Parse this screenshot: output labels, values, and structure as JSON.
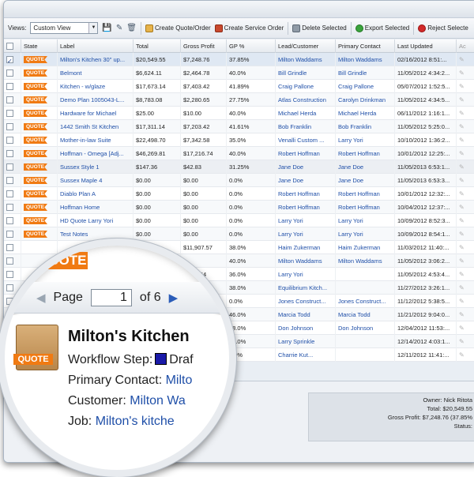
{
  "toolbar": {
    "views_label": "Views:",
    "view_value": "Custom View",
    "create_quote": "Create Quote/Order",
    "create_service": "Create Service Order",
    "delete_selected": "Delete Selected",
    "export_selected": "Export Selected",
    "reject_selected": "Reject Selecte"
  },
  "columns": [
    "State",
    "Label",
    "Total",
    "Gross Profit",
    "GP %",
    "Lead/Customer",
    "Primary Contact",
    "Last Updated",
    "Ac"
  ],
  "rows": [
    {
      "badge": "QUOTE",
      "label": "Milton's Kitchen 30\" up...",
      "total": "$20,549.55",
      "gp": "$7,248.76",
      "gpp": "37.85%",
      "lead": "Milton Waddams",
      "contact": "Milton Waddams",
      "updated": "02/16/2012 8:51:..."
    },
    {
      "badge": "QUOTE",
      "label": "Belmont",
      "total": "$6,624.11",
      "gp": "$2,464.78",
      "gpp": "40.0%",
      "lead": "Bill Grindle",
      "contact": "Bill Grindle",
      "updated": "11/05/2012 4:34:2..."
    },
    {
      "badge": "QUOTE",
      "label": "Kitchen - w/glaze",
      "total": "$17,673.14",
      "gp": "$7,403.42",
      "gpp": "41.89%",
      "lead": "Craig Pallone",
      "contact": "Craig Pallone",
      "updated": "05/07/2012 1:52:5..."
    },
    {
      "badge": "QUOTE",
      "label": "Demo Plan 1005043-L...",
      "total": "$8,783.08",
      "gp": "$2,280.65",
      "gpp": "27.75%",
      "lead": "Atlas Construction",
      "contact": "Carolyn Drinkman",
      "updated": "11/05/2012 4:34:5..."
    },
    {
      "badge": "QUOTE",
      "label": "Hardware for Michael",
      "total": "$25.00",
      "gp": "$10.00",
      "gpp": "40.0%",
      "lead": "Michael Herda",
      "contact": "Michael Herda",
      "updated": "06/11/2012 1:16:1..."
    },
    {
      "badge": "QUOTE",
      "label": "1442 Smith St Kitchen",
      "total": "$17,311.14",
      "gp": "$7,203.42",
      "gpp": "41.61%",
      "lead": "Bob Franklin",
      "contact": "Bob Franklin",
      "updated": "11/05/2012 5:25:0..."
    },
    {
      "badge": "QUOTE",
      "label": "Mother-in-law Suite",
      "total": "$22,498.70",
      "gp": "$7,342.58",
      "gpp": "35.0%",
      "lead": "Venalli Custom ...",
      "contact": "Larry Yori",
      "updated": "10/10/2012 1:36:2..."
    },
    {
      "badge": "QUOTE",
      "label": "Hoffman - Omega [Adj...",
      "total": "$46,269.81",
      "gp": "$17,216.74",
      "gpp": "40.0%",
      "lead": "Robert Hoffman",
      "contact": "Robert Hoffman",
      "updated": "10/01/2012 12:25:..."
    },
    {
      "badge": "QUOTE",
      "label": "Sussex Style 1",
      "total": "$147.36",
      "gp": "$42.83",
      "gpp": "31.25%",
      "lead": "Jane Doe",
      "contact": "Jane Doe",
      "updated": "11/05/2013 6:53:1..."
    },
    {
      "badge": "QUOTE",
      "label": "Sussex Maple 4",
      "total": "$0.00",
      "gp": "$0.00",
      "gpp": "0.0%",
      "lead": "Jane Doe",
      "contact": "Jane Doe",
      "updated": "11/05/2013 6:53:3..."
    },
    {
      "badge": "QUOTE",
      "label": "Diablo Plan A",
      "total": "$0.00",
      "gp": "$0.00",
      "gpp": "0.0%",
      "lead": "Robert Hoffman",
      "contact": "Robert Hoffman",
      "updated": "10/01/2012 12:32:..."
    },
    {
      "badge": "QUOTE",
      "label": "Hoffman Home",
      "total": "$0.00",
      "gp": "$0.00",
      "gpp": "0.0%",
      "lead": "Robert Hoffman",
      "contact": "Robert Hoffman",
      "updated": "10/04/2012 12:37:..."
    },
    {
      "badge": "QUOTE",
      "label": "HD Quote Larry Yori",
      "total": "$0.00",
      "gp": "$0.00",
      "gpp": "0.0%",
      "lead": "Larry Yori",
      "contact": "Larry Yori",
      "updated": "10/09/2012 8:52:3..."
    },
    {
      "badge": "QUOTE",
      "label": "Test Notes",
      "total": "$0.00",
      "gp": "$0.00",
      "gpp": "0.0%",
      "lead": "Larry Yori",
      "contact": "Larry Yori",
      "updated": "10/09/2012 8:54:1..."
    },
    {
      "badge": "",
      "label": "",
      "total": "...06.78",
      "gp": "$11,907.57",
      "gpp": "38.0%",
      "lead": "Haim Zukerman",
      "contact": "Haim Zukerman",
      "updated": "11/03/2012 11:40:..."
    },
    {
      "badge": "",
      "label": "",
      "total": "",
      "gp": "",
      "gpp": "40.0%",
      "lead": "Milton Waddams",
      "contact": "Milton Waddams",
      "updated": "11/05/2012 3:06:2..."
    },
    {
      "badge": "",
      "label": "",
      "total": "",
      "gp": "...061.64",
      "gpp": "36.0%",
      "lead": "Larry Yori",
      "contact": "",
      "updated": "11/05/2012 4:53:4..."
    },
    {
      "badge": "",
      "label": "",
      "total": "",
      "gp": "...65",
      "gpp": "38.0%",
      "lead": "Equilibrium Kitch...",
      "contact": "",
      "updated": "11/27/2012 3:26:1..."
    },
    {
      "badge": "",
      "label": "",
      "total": "",
      "gp": "",
      "gpp": "0.0%",
      "lead": "Jones Construct...",
      "contact": "Jones Construct...",
      "updated": "11/12/2012 5:38:5..."
    },
    {
      "badge": "",
      "label": "",
      "total": "",
      "gp": "",
      "gpp": "46.0%",
      "lead": "Marcia Todd",
      "contact": "Marcia Todd",
      "updated": "11/21/2012 9:04:0..."
    },
    {
      "badge": "",
      "label": "",
      "total": "",
      "gp": "",
      "gpp": "38.0%",
      "lead": "Don Johnson",
      "contact": "Don Johnson",
      "updated": "12/04/2012 11:53:..."
    },
    {
      "badge": "",
      "label": "",
      "total": "",
      "gp": "",
      "gpp": "39.0%",
      "lead": "Larry Sprinkle",
      "contact": "",
      "updated": "12/14/2012 4:03:1..."
    },
    {
      "badge": "",
      "label": "",
      "total": "",
      "gp": "",
      "gpp": "0.0%",
      "lead": "Charrie Kut...",
      "contact": "",
      "updated": "12/11/2012 11:41:..."
    }
  ],
  "summary": {
    "owner": "Owner: Nick Ritota",
    "total": "Total: $20,549.55",
    "gross": "Gross Profit: $7,248.76 (37.85%",
    "status": "Status:"
  },
  "magnifier": {
    "badge": "QUOTE",
    "page_label": "Page",
    "page_value": "1",
    "of_label": "of 6",
    "title": "Milton's Kitchen",
    "workflow_label": "Workflow Step:",
    "workflow_value": "Draf",
    "contact_label": "Primary Contact:",
    "contact_value": "Milto",
    "customer_label": "Customer:",
    "customer_value": "Milton Wa",
    "job_label": "Job:",
    "job_value": "Milton's kitche",
    "box_label": "QUOTE"
  },
  "icon_names": [
    "save-icon",
    "edit-icon",
    "delete-icon",
    "quote-icon",
    "service-order-icon",
    "trash-icon",
    "export-icon",
    "reject-icon",
    "pencil-icon",
    "chevron-down-icon",
    "prev-page-icon",
    "next-page-icon",
    "quote-box-icon"
  ],
  "colors": {
    "badge": "#f07a12",
    "link": "#1f4fa8",
    "selected_row": "#dfe8f3"
  }
}
